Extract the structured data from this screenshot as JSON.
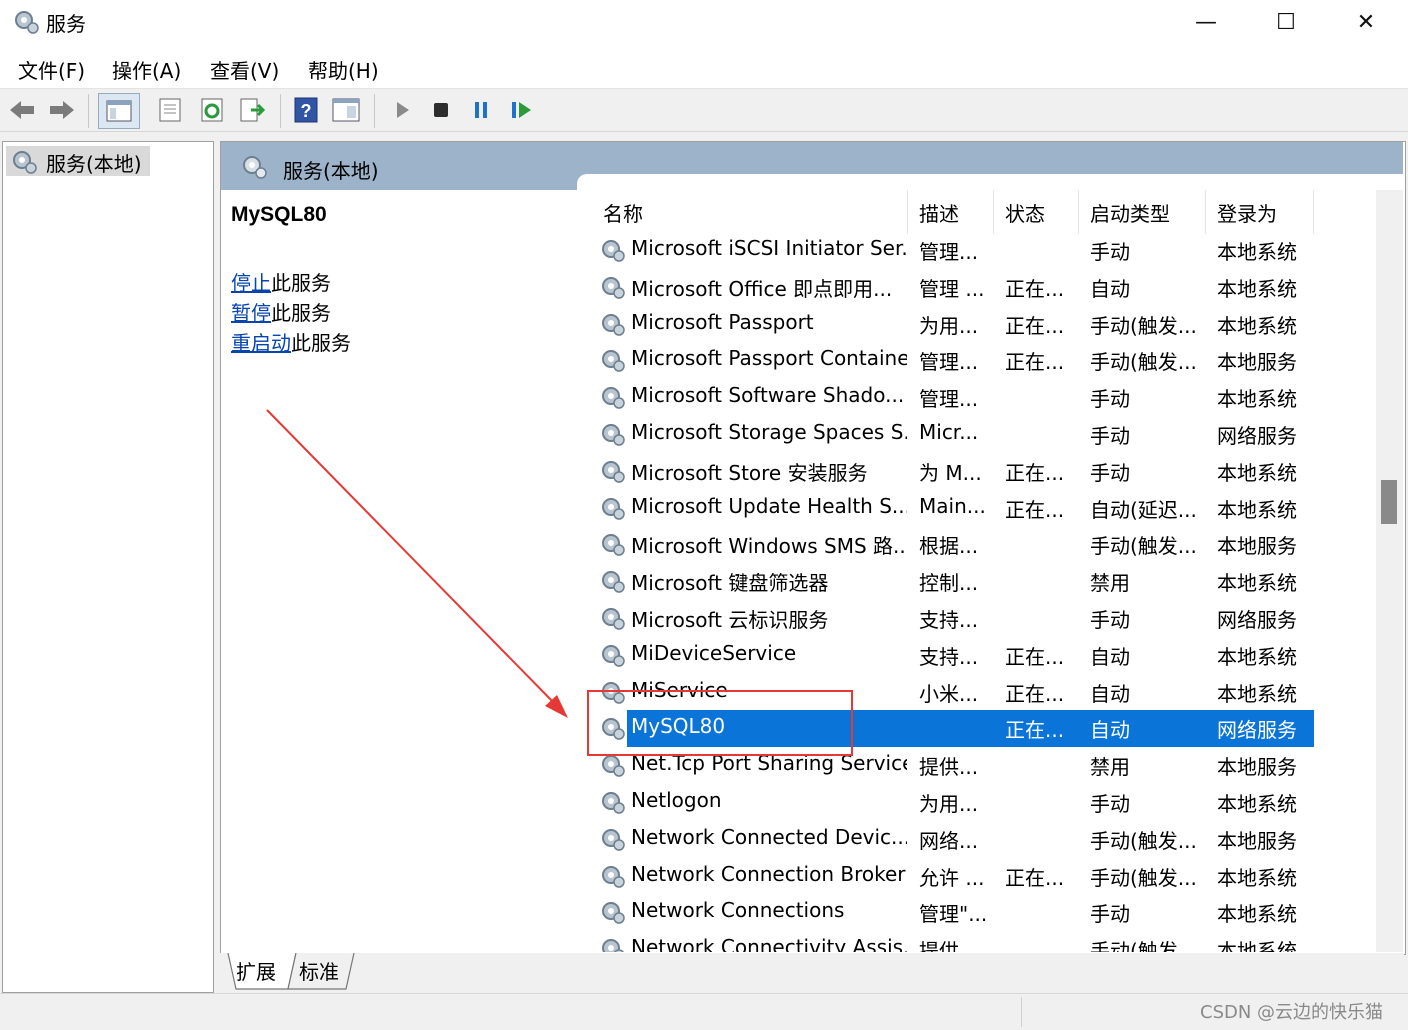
{
  "window": {
    "title": "服务",
    "minimize_glyph": "—",
    "maximize_glyph": "☐",
    "close_glyph": "✕"
  },
  "menu": [
    "文件(F)",
    "操作(A)",
    "查看(V)",
    "帮助(H)"
  ],
  "toolbar": {
    "icons": [
      "back-arrow-icon",
      "forward-arrow-icon",
      "show-console-tree-icon",
      "properties-icon",
      "refresh-icon",
      "export-list-icon",
      "help-icon",
      "console-pane-icon",
      "start-service-icon",
      "stop-service-icon",
      "pause-service-icon",
      "restart-service-icon"
    ]
  },
  "tree": {
    "root_label": "服务(本地)"
  },
  "pane": {
    "header_title": "服务(本地)"
  },
  "detail": {
    "service_name": "MySQL80",
    "actions": [
      {
        "link": "停止",
        "suffix": "此服务"
      },
      {
        "link": "暂停",
        "suffix": "此服务"
      },
      {
        "link": "重启动",
        "suffix": "此服务"
      }
    ]
  },
  "list": {
    "sort_indicator": "˄",
    "columns": [
      "名称",
      "描述",
      "状态",
      "启动类型",
      "登录为"
    ],
    "rows": [
      [
        "Microsoft iSCSI Initiator Ser...",
        "管理...",
        "",
        "手动",
        "本地系统"
      ],
      [
        "Microsoft Office 即点即用...",
        "管理 ...",
        "正在...",
        "自动",
        "本地系统"
      ],
      [
        "Microsoft Passport",
        "为用...",
        "正在...",
        "手动(触发...",
        "本地系统"
      ],
      [
        "Microsoft Passport Container",
        "管理...",
        "正在...",
        "手动(触发...",
        "本地服务"
      ],
      [
        "Microsoft Software Shado...",
        "管理...",
        "",
        "手动",
        "本地系统"
      ],
      [
        "Microsoft Storage Spaces S...",
        "Micr...",
        "",
        "手动",
        "网络服务"
      ],
      [
        "Microsoft Store 安装服务",
        "为 M...",
        "正在...",
        "手动",
        "本地系统"
      ],
      [
        "Microsoft Update Health S...",
        "Main...",
        "正在...",
        "自动(延迟...",
        "本地系统"
      ],
      [
        "Microsoft Windows SMS 路...",
        "根据...",
        "",
        "手动(触发...",
        "本地服务"
      ],
      [
        "Microsoft 键盘筛选器",
        "控制...",
        "",
        "禁用",
        "本地系统"
      ],
      [
        "Microsoft 云标识服务",
        "支持...",
        "",
        "手动",
        "网络服务"
      ],
      [
        "MiDeviceService",
        "支持...",
        "正在...",
        "自动",
        "本地系统"
      ],
      [
        "MiService",
        "小米...",
        "正在...",
        "自动",
        "本地系统"
      ],
      [
        "MySQL80",
        "",
        "正在...",
        "自动",
        "网络服务"
      ],
      [
        "Net.Tcp Port Sharing Service",
        "提供...",
        "",
        "禁用",
        "本地服务"
      ],
      [
        "Netlogon",
        "为用...",
        "",
        "手动",
        "本地系统"
      ],
      [
        "Network Connected Devic...",
        "网络...",
        "",
        "手动(触发...",
        "本地服务"
      ],
      [
        "Network Connection Broker",
        "允许 ...",
        "正在...",
        "手动(触发...",
        "本地系统"
      ],
      [
        "Network Connections",
        "管理\"...",
        "",
        "手动",
        "本地系统"
      ],
      [
        "Network Connectivity Assis...",
        "提供...",
        "",
        "手动(触发...",
        "本地系统"
      ]
    ],
    "selected_index": 13
  },
  "tabs": [
    "扩展",
    "标准"
  ],
  "status": {
    "watermark": "CSDN @云边的快乐猫"
  },
  "colors": {
    "selection": "#0a74d8",
    "header": "#9cb3c9",
    "link": "#0645ad",
    "annotation": "#e53935"
  }
}
